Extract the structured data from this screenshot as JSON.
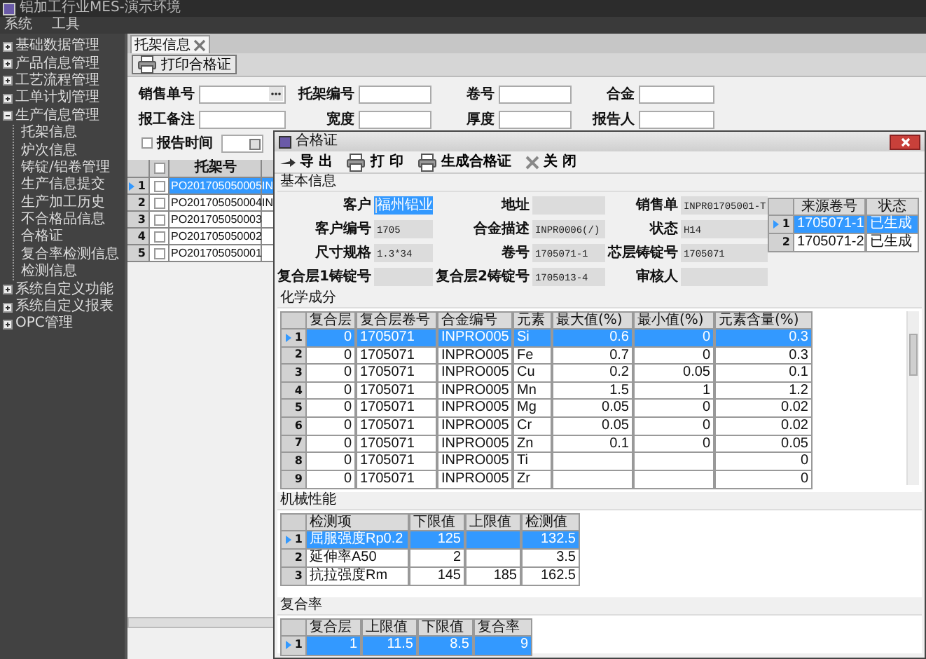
{
  "window": {
    "title": "铝加工行业MES-演示环境"
  },
  "menu": [
    "系统",
    "工具"
  ],
  "sidebar": {
    "items": [
      {
        "label": "基础数据管理",
        "expanded": false
      },
      {
        "label": "产品信息管理",
        "expanded": false
      },
      {
        "label": "工艺流程管理",
        "expanded": false
      },
      {
        "label": "工单计划管理",
        "expanded": false
      },
      {
        "label": "生产信息管理",
        "expanded": true,
        "children": [
          {
            "label": "托架信息"
          },
          {
            "label": "炉次信息"
          },
          {
            "label": "铸锭/铝卷管理"
          },
          {
            "label": "生产信息提交"
          },
          {
            "label": "生产加工历史"
          },
          {
            "label": "不合格品信息"
          },
          {
            "label": "合格证"
          },
          {
            "label": "复合率检测信息"
          },
          {
            "label": "检测信息"
          }
        ]
      },
      {
        "label": "系统自定义功能",
        "expanded": false
      },
      {
        "label": "系统自定义报表",
        "expanded": false
      },
      {
        "label": "OPC管理",
        "expanded": false
      }
    ]
  },
  "tabs": [
    {
      "label": "托架信息",
      "selected": true
    }
  ],
  "toolbar": {
    "buttons": [
      "打印合格证"
    ]
  },
  "filters": {
    "rows": [
      [
        {
          "label": "销售单号",
          "kind": "lookup"
        },
        {
          "label": "托架编号",
          "kind": "text"
        },
        {
          "label": "卷号",
          "kind": "text"
        },
        {
          "label": "合金",
          "kind": "text"
        }
      ],
      [
        {
          "label": "报工备注",
          "kind": "text"
        },
        {
          "label": "宽度",
          "kind": "text"
        },
        {
          "label": "厚度",
          "kind": "text"
        },
        {
          "label": "报告人",
          "kind": "text"
        }
      ]
    ],
    "report_time": {
      "label": "报告时间",
      "checked": false
    }
  },
  "table": {
    "columns": [
      "托架号"
    ],
    "header_checked": false,
    "rows": [
      {
        "no": "1",
        "selected": true,
        "checked": false,
        "cells": [
          "PO201705050005",
          "IN"
        ]
      },
      {
        "no": "2",
        "selected": false,
        "checked": false,
        "cells": [
          "PO201705050004",
          "IN"
        ]
      },
      {
        "no": "3",
        "selected": false,
        "checked": false,
        "cells": [
          "PO201705050003"
        ]
      },
      {
        "no": "4",
        "selected": false,
        "checked": false,
        "cells": [
          "PO201705050002"
        ]
      },
      {
        "no": "5",
        "selected": false,
        "checked": false,
        "cells": [
          "PO201705050001"
        ]
      }
    ]
  },
  "dialog": {
    "title": "合格证",
    "toolbar": [
      {
        "label": "导 出",
        "kind": "export"
      },
      {
        "label": "打 印",
        "kind": "print"
      },
      {
        "label": "生成合格证",
        "kind": "print"
      },
      {
        "label": "关 闭",
        "kind": "close"
      }
    ],
    "basic_info": {
      "title": "基本信息",
      "fields": [
        {
          "label": "客户",
          "value": "福州铝业",
          "selected": true
        },
        {
          "label": "地址",
          "selected": false
        },
        {
          "label": "销售单",
          "value": "INPR01705001-T",
          "selected": false
        },
        {
          "label": "客户编号",
          "value": "1705",
          "selected": false
        },
        {
          "label": "合金描述",
          "value": "INPR0006(/)",
          "selected": false
        },
        {
          "label": "状态",
          "value": "H14",
          "selected": false
        },
        {
          "label": "尺寸规格",
          "value": "1.3*34",
          "selected": false
        },
        {
          "label": "卷号",
          "value": "1705071-1",
          "selected": false
        },
        {
          "label": "芯层铸锭号",
          "value": "1705071",
          "selected": false
        },
        {
          "label": "复合层1铸锭号",
          "selected": false
        },
        {
          "label": "复合层2铸锭号",
          "value": "1705013-4",
          "selected": false
        },
        {
          "label": "审核人",
          "selected": false
        }
      ],
      "source_table": {
        "columns": [
          "来源卷号",
          "状态"
        ],
        "rows": [
          {
            "no": "1",
            "selected": true,
            "cells": [
              "1705071-1",
              "已生成"
            ]
          },
          {
            "no": "2",
            "selected": false,
            "cells": [
              "1705071-2",
              "已生成"
            ]
          }
        ]
      }
    },
    "chemistry": {
      "title": "化学成分",
      "columns": [
        "复合层",
        "复合层卷号",
        "合金编号",
        "元素",
        "最大值(%)",
        "最小值(%)",
        "元素含量(%)"
      ],
      "rows": [
        {
          "no": "1",
          "selected": true,
          "cells": [
            "0",
            "1705071",
            "INPRO005",
            "Si",
            "0.6",
            "0",
            "0.3"
          ]
        },
        {
          "no": "2",
          "selected": false,
          "cells": [
            "0",
            "1705071",
            "INPRO005",
            "Fe",
            "0.7",
            "0",
            "0.3"
          ]
        },
        {
          "no": "3",
          "selected": false,
          "cells": [
            "0",
            "1705071",
            "INPRO005",
            "Cu",
            "0.2",
            "0.05",
            "0.1"
          ]
        },
        {
          "no": "4",
          "selected": false,
          "cells": [
            "0",
            "1705071",
            "INPRO005",
            "Mn",
            "1.5",
            "1",
            "1.2"
          ]
        },
        {
          "no": "5",
          "selected": false,
          "cells": [
            "0",
            "1705071",
            "INPRO005",
            "Mg",
            "0.05",
            "0",
            "0.02"
          ]
        },
        {
          "no": "6",
          "selected": false,
          "cells": [
            "0",
            "1705071",
            "INPRO005",
            "Cr",
            "0.05",
            "0",
            "0.02"
          ]
        },
        {
          "no": "7",
          "selected": false,
          "cells": [
            "0",
            "1705071",
            "INPRO005",
            "Zn",
            "0.1",
            "0",
            "0.05"
          ]
        },
        {
          "no": "8",
          "selected": false,
          "cells": [
            "0",
            "1705071",
            "INPRO005",
            "Ti",
            null,
            null,
            "0"
          ]
        },
        {
          "no": "9",
          "selected": false,
          "cells": [
            "0",
            "1705071",
            "INPRO005",
            "Zr",
            null,
            null,
            "0"
          ]
        }
      ]
    },
    "mechanical": {
      "title": "机械性能",
      "columns": [
        "检测项",
        "下限值",
        "上限值",
        "检测值"
      ],
      "rows": [
        {
          "no": "1",
          "selected": true,
          "cells": [
            "屈服强度Rp0.2",
            "125",
            null,
            "132.5"
          ]
        },
        {
          "no": "2",
          "selected": false,
          "cells": [
            "延伸率A50",
            "2",
            null,
            "3.5"
          ]
        },
        {
          "no": "3",
          "selected": false,
          "cells": [
            "抗拉强度Rm",
            "145",
            "185",
            "162.5"
          ]
        }
      ]
    },
    "composite_rate": {
      "title": "复合率",
      "columns": [
        "复合层",
        "上限值",
        "下限值",
        "复合率"
      ],
      "rows": [
        {
          "no": "1",
          "selected": true,
          "cells": [
            "1",
            "11.5",
            "8.5",
            "9"
          ]
        }
      ]
    }
  }
}
